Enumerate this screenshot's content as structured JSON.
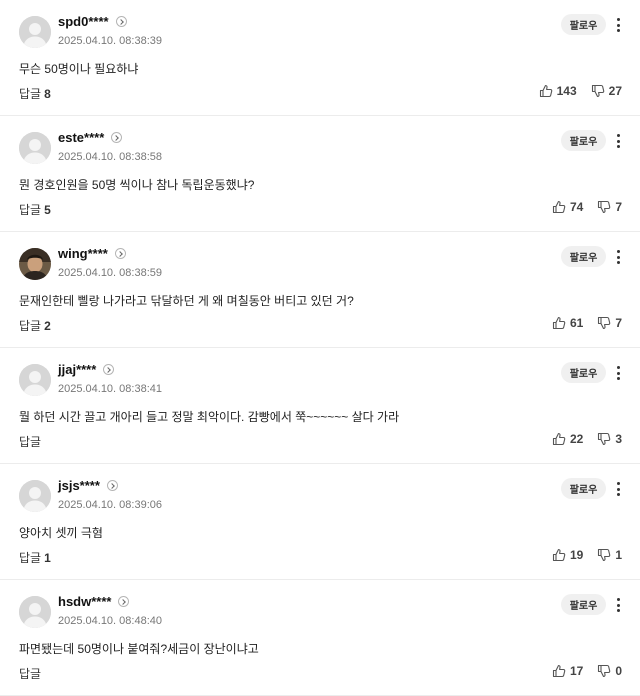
{
  "follow_label": "팔로우",
  "reply_label": "답글",
  "comments": [
    {
      "user": "spd0****",
      "date": "2025.04.10. 08:38:39",
      "text": "무슨 50명이나 필요하냐",
      "replies": "8",
      "likes": "143",
      "dislikes": "27",
      "avatar": "default"
    },
    {
      "user": "este****",
      "date": "2025.04.10. 08:38:58",
      "text": "뭔 경호인원을 50명 씩이나 참나 독립운동했냐?",
      "replies": "5",
      "likes": "74",
      "dislikes": "7",
      "avatar": "default"
    },
    {
      "user": "wing****",
      "date": "2025.04.10. 08:38:59",
      "text": "문재인한테 삘랑 나가라고 닦달하던 게 왜 며칠동안 버티고 있던 거?",
      "replies": "2",
      "likes": "61",
      "dislikes": "7",
      "avatar": "photo"
    },
    {
      "user": "jjaj****",
      "date": "2025.04.10. 08:38:41",
      "text": "뭘 하던 시간 끌고 개아리 들고 정말 최악이다. 감빵에서 쭉~~~~~~ 살다 가라",
      "replies": "",
      "likes": "22",
      "dislikes": "3",
      "avatar": "default"
    },
    {
      "user": "jsjs****",
      "date": "2025.04.10. 08:39:06",
      "text": "양아치 셋끼 극혐",
      "replies": "1",
      "likes": "19",
      "dislikes": "1",
      "avatar": "default"
    },
    {
      "user": "hsdw****",
      "date": "2025.04.10. 08:48:40",
      "text": "파면됐는데 50명이나 붙여줘?세금이 장난이냐고",
      "replies": "",
      "likes": "17",
      "dislikes": "0",
      "avatar": "default"
    }
  ]
}
